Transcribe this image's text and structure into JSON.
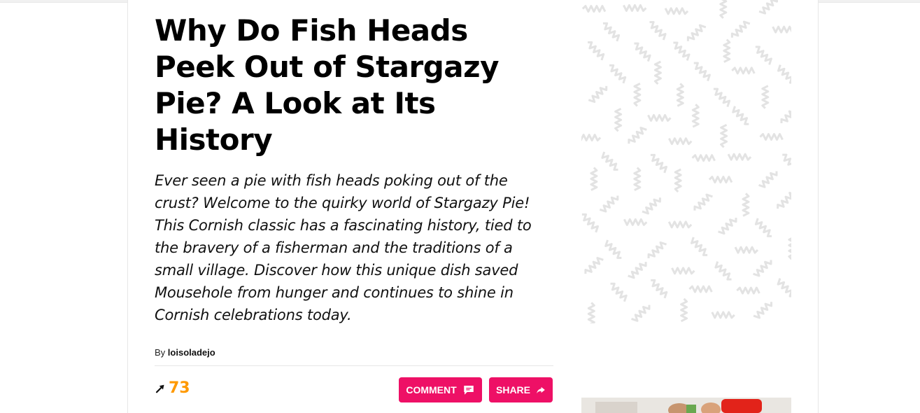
{
  "article": {
    "title": "Why Do Fish Heads Peek Out of Stargazy Pie? A Look at Its History",
    "lede": "Ever seen a pie with fish heads poking out of the crust? Welcome to the quirky world of Stargazy Pie! This Cornish classic has a fascinating history, tied to the bravery of a fisherman and the traditions of a small village. Discover how this unique dish saved Mousehole from hunger and continues to shine in Cornish celebrations today.",
    "byline_prefix": "By",
    "author": "loisoladejo"
  },
  "stats": {
    "trending_icon": "trending-arrow-icon",
    "count": "73"
  },
  "actions": {
    "comment_label": "COMMENT",
    "comment_icon": "speech-bubble-icon",
    "share_label": "SHARE",
    "share_icon": "share-arrow-icon"
  },
  "colors": {
    "accent_pink": "#ee1066",
    "count_orange": "#ff9900",
    "pattern_gray": "#e3e3e3"
  }
}
